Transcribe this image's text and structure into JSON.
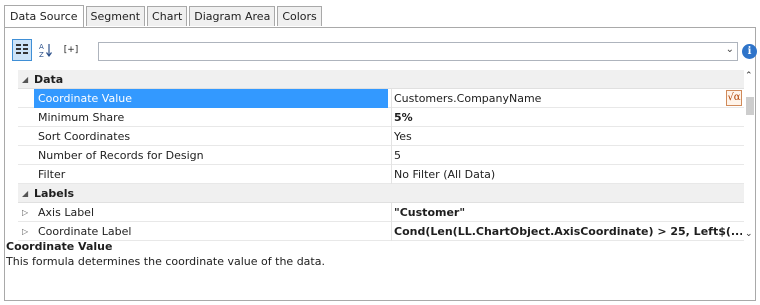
{
  "tabs": [
    "Data Source",
    "Segment",
    "Chart",
    "Diagram Area",
    "Colors"
  ],
  "toolbar": {
    "categorized_icon": "categorized-view-icon",
    "sort_icon": "alphabetical-sort-icon",
    "expand_icon": "expand-all-icon",
    "expand_label": "[+]",
    "combo_value": "",
    "info_label": "i"
  },
  "grid": {
    "categories": [
      {
        "label": "Data",
        "rows": [
          {
            "name": "Coordinate Value",
            "value": "Customers.CompanyName"
          },
          {
            "name": "Minimum Share",
            "value": "5%"
          },
          {
            "name": "Sort Coordinates",
            "value": "Yes"
          },
          {
            "name": "Number of Records for Design",
            "value": "5"
          },
          {
            "name": "Filter",
            "value": "No Filter (All Data)"
          }
        ]
      },
      {
        "label": "Labels",
        "rows": [
          {
            "name": "Axis Label",
            "value": "\"Customer\""
          },
          {
            "name": "Coordinate Label",
            "value": "Cond(Len(LL.ChartObject.AxisCoordinate) > 25, Left$(... "
          }
        ]
      }
    ],
    "formula_button_label": "√α"
  },
  "description": {
    "title": "Coordinate Value",
    "text": "This formula determines the coordinate value of the data."
  },
  "colors": {
    "selection": "#3399ff",
    "category_bg": "#f0f0f0",
    "info": "#2f74c9"
  }
}
